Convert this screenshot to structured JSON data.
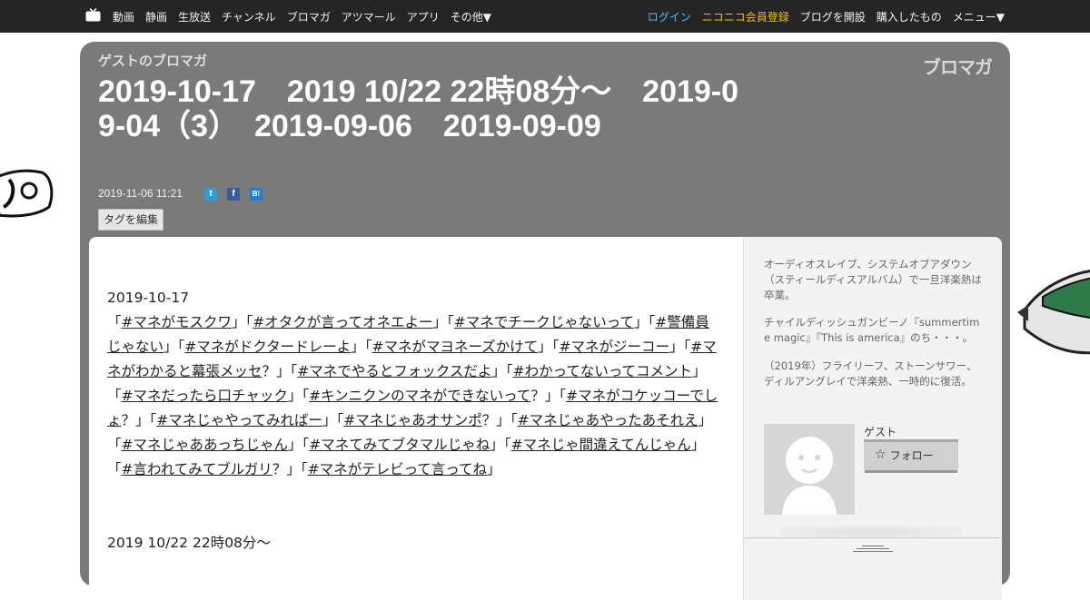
{
  "nav": {
    "left": [
      "動画",
      "静画",
      "生放送",
      "チャンネル",
      "ブロマガ",
      "アツマール",
      "アプリ",
      "その他▼"
    ],
    "login": "ログイン",
    "register": "ニコニコ会員登録",
    "open_blog": "ブログを開設",
    "purchased": "購入したもの",
    "menu": "メニュー▼"
  },
  "blog": {
    "name": "ゲストのブロマガ",
    "brand": "ブロマガ"
  },
  "post": {
    "title": "2019-10-17　2019 10/22 22時08分〜　2019-09-04（3）　2019-09-06　2019-09-09",
    "date": "2019-11-06 11:21",
    "tag_edit_label": "タグを編集",
    "share": {
      "twitter": "twitter-icon",
      "facebook": "facebook-icon",
      "hatena": "hatena-bookmark-icon"
    }
  },
  "article": {
    "section1_date": "2019-10-17",
    "tags": [
      {
        "pre": "「",
        "text": "#マネがモスクワ",
        "post": "」"
      },
      {
        "pre": "「",
        "text": "#オタクが言ってオネエよー",
        "post": "」"
      },
      {
        "pre": "「",
        "text": "#マネでチークじゃないって",
        "post": "」"
      },
      {
        "pre": "「",
        "text": "#警備員じゃない",
        "post": "」"
      },
      {
        "pre": "「",
        "text": "#マネがドクタードレーよ",
        "post": "」"
      },
      {
        "pre": "「",
        "text": "#マネがマヨネーズかけて",
        "post": "」"
      },
      {
        "pre": "「",
        "text": "#マネがジーコー",
        "post": "」"
      },
      {
        "pre": "「",
        "text": "#マネがわかると幕張メッセ",
        "post": "？」"
      },
      {
        "pre": "「",
        "text": "#マネでやるとフォックスだよ",
        "post": "」"
      },
      {
        "pre": "「",
        "text": "#わかってないってコメント",
        "post": "」"
      },
      {
        "pre": "「",
        "text": "#マネだったら口チャック",
        "post": "」"
      },
      {
        "pre": "「",
        "text": "#キンニクンのマネができないって",
        "post": "？」"
      },
      {
        "pre": "「",
        "text": "#マネがコケッコーでしょ",
        "post": "？」"
      },
      {
        "pre": "「",
        "text": "#マネじゃやってみればー",
        "post": "」"
      },
      {
        "pre": "「",
        "text": "#マネじゃあオサンポ",
        "post": "？」"
      },
      {
        "pre": "「",
        "text": "#マネじゃあやったあそれえ",
        "post": "」"
      },
      {
        "pre": "「",
        "text": "#マネじゃああっちじゃん",
        "post": "」"
      },
      {
        "pre": "「",
        "text": "#マネてみてブタマルじゃね",
        "post": "」"
      },
      {
        "pre": "「",
        "text": "#マネじゃ間違えてんじゃん",
        "post": "」"
      },
      {
        "pre": "「",
        "text": "#言われてみてブルガリ",
        "post": "？」"
      },
      {
        "pre": "「",
        "text": "#マネがテレビって言ってね",
        "post": "」"
      }
    ],
    "section2_date": "2019 10/22 22時08分〜"
  },
  "sidebar": {
    "profile": [
      "オーディオスレイブ、システムオブアダウン（スティールディスアルバム）で一旦洋楽熱は卒業。",
      "チャイルディッシュガンビーノ『summertime magic』『This is america』のち・・・。",
      "（2019年）フライリーフ、ストーンサワー、ディルアングレイで洋楽熱、一時的に復活。"
    ],
    "user_name": "ゲスト",
    "follow_label": "フォロー"
  },
  "colors": {
    "topbar": "#252525",
    "panel": "#7a7a7a",
    "login": "#4fc1f0",
    "register": "#f0c000"
  }
}
